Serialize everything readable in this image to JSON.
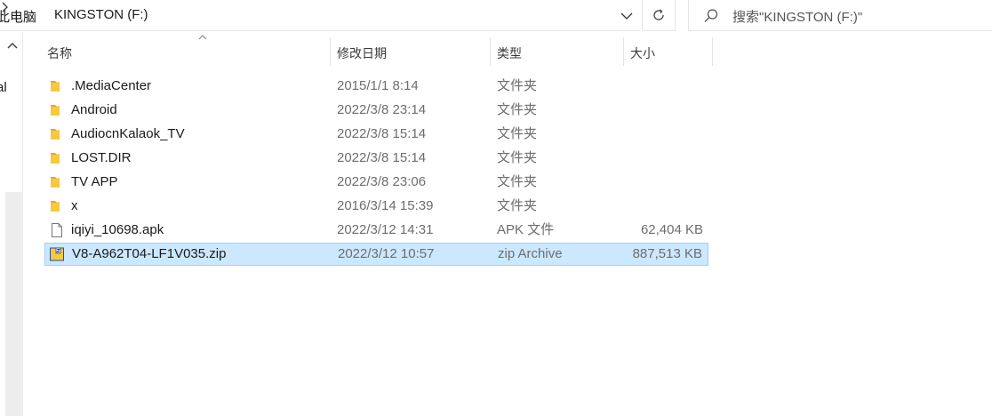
{
  "addressbar": {
    "parent_crumb": "此电脑",
    "current_crumb": "KINGSTON (F:)"
  },
  "search": {
    "placeholder": "搜索\"KINGSTON (F:)\""
  },
  "nav": {
    "cut_text": "al"
  },
  "columns": {
    "name": "名称",
    "date": "修改日期",
    "type": "类型",
    "size": "大小"
  },
  "files": [
    {
      "name": ".MediaCenter",
      "date": "2015/1/1 8:14",
      "type": "文件夹",
      "size": "",
      "icon": "folder-icon",
      "selected": false
    },
    {
      "name": "Android",
      "date": "2022/3/8 23:14",
      "type": "文件夹",
      "size": "",
      "icon": "folder-icon",
      "selected": false
    },
    {
      "name": "AudiocnKalaok_TV",
      "date": "2022/3/8 15:14",
      "type": "文件夹",
      "size": "",
      "icon": "folder-icon",
      "selected": false
    },
    {
      "name": "LOST.DIR",
      "date": "2022/3/8 15:14",
      "type": "文件夹",
      "size": "",
      "icon": "folder-icon",
      "selected": false
    },
    {
      "name": "TV APP",
      "date": "2022/3/8 23:06",
      "type": "文件夹",
      "size": "",
      "icon": "folder-icon",
      "selected": false
    },
    {
      "name": "x",
      "date": "2016/3/14 15:39",
      "type": "文件夹",
      "size": "",
      "icon": "folder-icon",
      "selected": false
    },
    {
      "name": "iqiyi_10698.apk",
      "date": "2022/3/12 14:31",
      "type": "APK 文件",
      "size": "62,404 KB",
      "icon": "file-icon",
      "selected": false
    },
    {
      "name": "V8-A962T04-LF1V035.zip",
      "date": "2022/3/12 10:57",
      "type": "zip Archive",
      "size": "887,513 KB",
      "icon": "zip-archive-icon",
      "selected": true
    }
  ],
  "colors": {
    "selection_bg": "#cce8ff",
    "selection_border": "#99d1ff",
    "folder_yellow": "#f8c93d"
  }
}
